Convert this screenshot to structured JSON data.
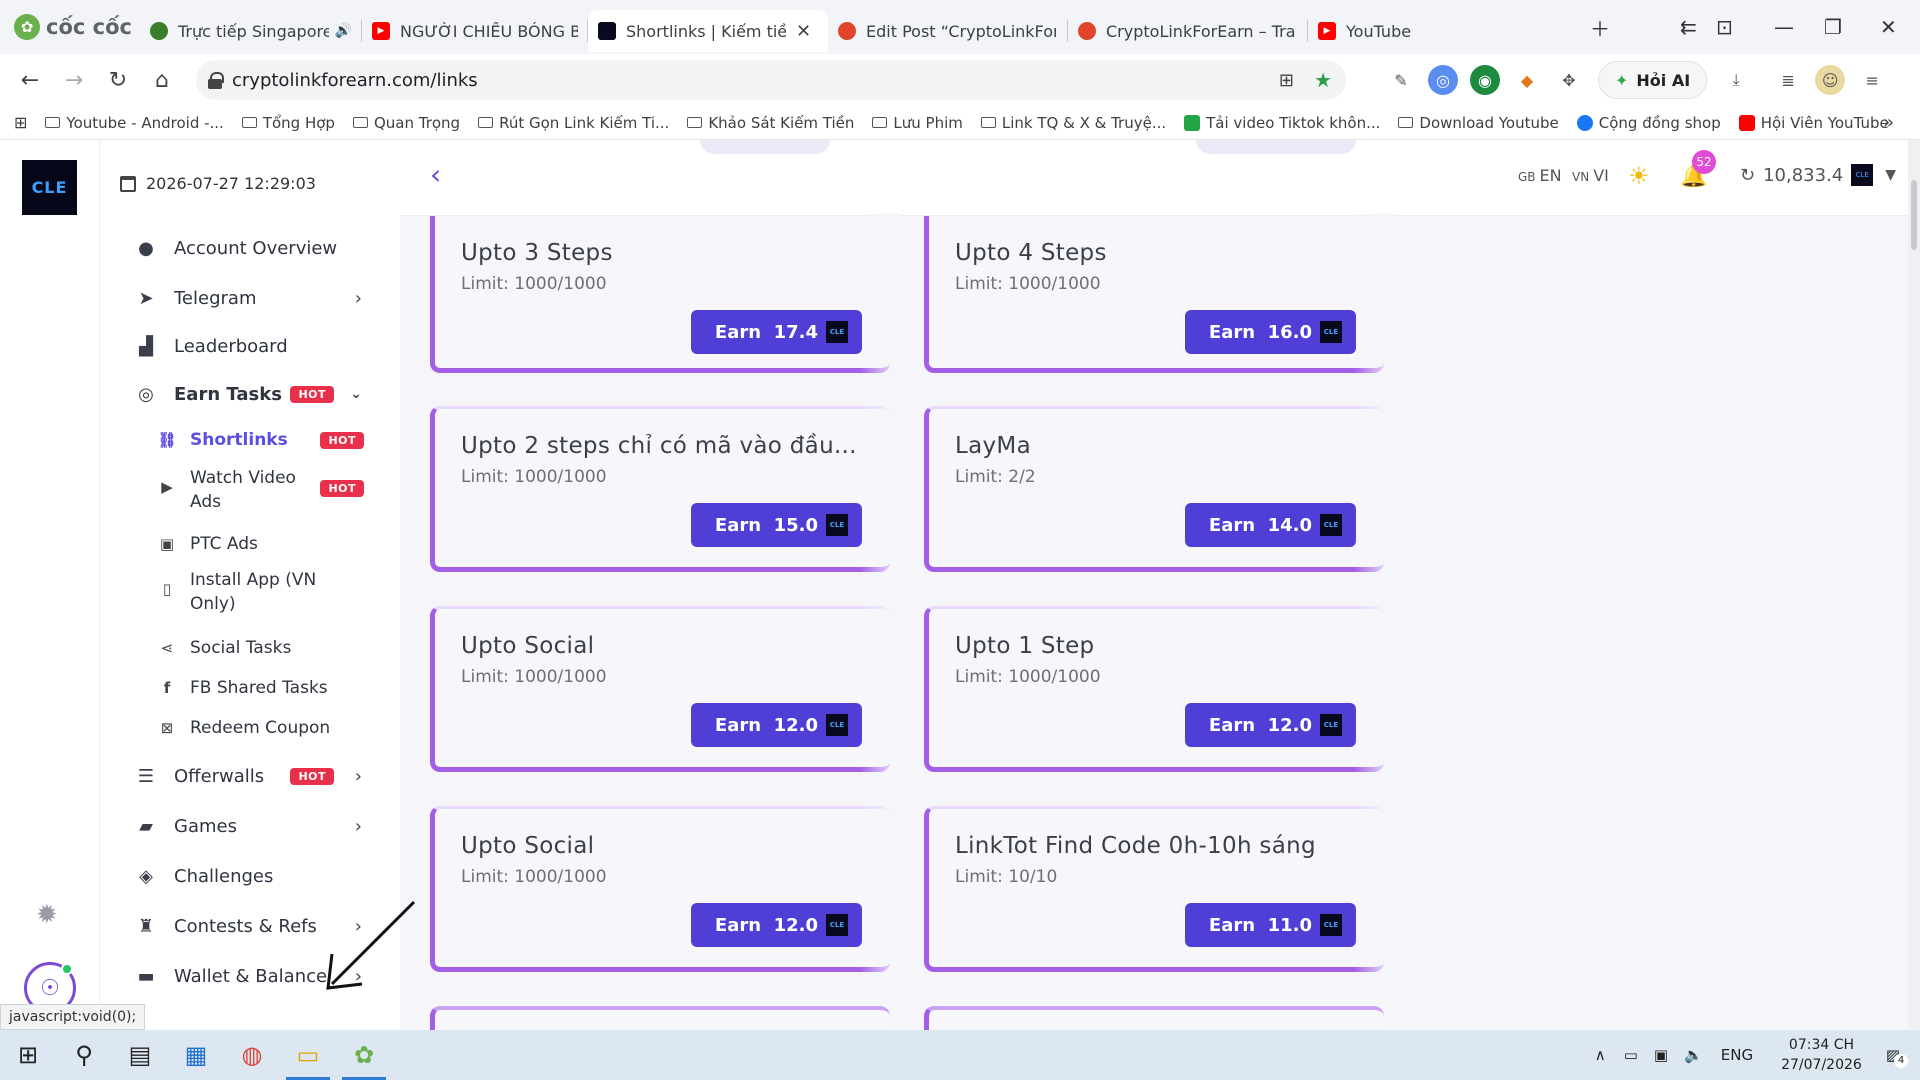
{
  "browser": {
    "brand": "cốc cốc",
    "tabs": [
      {
        "title": "Trực tiếp Singapore vs",
        "fav_color": "#3a7d2a"
      },
      {
        "title": "NGƯỜI CHIẾU BÓNG BỊ BỎ",
        "fav_color": "#ff0000"
      },
      {
        "title": "Shortlinks | Kiếm tiền",
        "fav_color": "#0a0a1e",
        "active": true
      },
      {
        "title": "Edit Post “CryptoLinkForEa",
        "fav_color": "#e0452b"
      },
      {
        "title": "CryptoLinkForEarn – Trang",
        "fav_color": "#e0452b"
      },
      {
        "title": "YouTube",
        "fav_color": "#ff0000"
      }
    ],
    "url": "cryptolinkforearn.com/links",
    "ai_button": "Hỏi AI",
    "bookmarks": [
      {
        "label": "Youtube - Android -...",
        "type": "folder"
      },
      {
        "label": "Tổng Hợp",
        "type": "folder"
      },
      {
        "label": "Quan Trọng",
        "type": "folder"
      },
      {
        "label": "Rút Gọn Link Kiếm Ti...",
        "type": "folder"
      },
      {
        "label": "Khảo Sát Kiếm Tiền",
        "type": "folder"
      },
      {
        "label": "Lưu Phim",
        "type": "folder"
      },
      {
        "label": "Link TQ & X & Truyệ...",
        "type": "folder"
      },
      {
        "label": "Tải video Tiktok khôn...",
        "type": "icon",
        "color": "#22a447"
      },
      {
        "label": "Download Youtube",
        "type": "folder"
      },
      {
        "label": "Cộng đồng shop",
        "type": "icon",
        "color": "#1877f2"
      },
      {
        "label": "Hội Viên YouTube",
        "type": "icon",
        "color": "#ff0000"
      }
    ]
  },
  "site": {
    "logo_text": "CLE",
    "datetime": "2026-07-27 12:29:03",
    "hot": "HOT",
    "menu": {
      "account": "Account Overview",
      "telegram": "Telegram",
      "leaderboard": "Leaderboard",
      "earn_tasks": "Earn Tasks",
      "offerwalls": "Offerwalls",
      "games": "Games",
      "challenges": "Challenges",
      "contests": "Contests & Refs",
      "wallet": "Wallet & Balance"
    },
    "submenu": {
      "shortlinks": "Shortlinks",
      "watch_video_1": "Watch Video",
      "watch_video_2": "Ads",
      "ptc": "PTC Ads",
      "install_1": "Install App (VN",
      "install_2": "Only)",
      "social": "Social Tasks",
      "fb": "FB Shared Tasks",
      "coupon": "Redeem Coupon"
    },
    "lang_gb": "GB",
    "lang_en": "EN",
    "lang_vn": "VN",
    "lang_vi": "VI",
    "notif_count": "52",
    "balance": "10,833.4",
    "coin_text": "CLE"
  },
  "cards": [
    {
      "title": "Upto 3 Steps",
      "limit": "Limit: 1000/1000",
      "earn": "Earn  17.4"
    },
    {
      "title": "Upto 4 Steps",
      "limit": "Limit: 1000/1000",
      "earn": "Earn  16.0"
    },
    {
      "title": "Upto 2 steps chỉ có mã vào đầu...",
      "limit": "Limit: 1000/1000",
      "earn": "Earn  15.0"
    },
    {
      "title": "LayMa",
      "limit": "Limit: 2/2",
      "earn": "Earn  14.0"
    },
    {
      "title": "Upto Social",
      "limit": "Limit: 1000/1000",
      "earn": "Earn  12.0"
    },
    {
      "title": "Upto 1 Step",
      "limit": "Limit: 1000/1000",
      "earn": "Earn  12.0"
    },
    {
      "title": "Upto Social",
      "limit": "Limit: 1000/1000",
      "earn": "Earn  12.0"
    },
    {
      "title": "LinkTot Find Code 0h-10h sáng",
      "limit": "Limit: 10/10",
      "earn": "Earn  11.0"
    }
  ],
  "status_url": "javascript:void(0);",
  "taskbar": {
    "lang": "ENG",
    "time": "07:34 CH",
    "date": "27/07/2026",
    "notif": "4"
  }
}
